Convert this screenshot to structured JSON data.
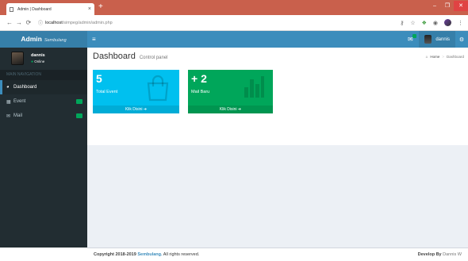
{
  "browser": {
    "tab_title": "Admin | Dashboard",
    "tab_close": "×",
    "new_tab": "+",
    "url_host": "localhost",
    "url_path": "/simpeg/admin/admin.php",
    "controls": {
      "minimize": "–",
      "maximize": "❐",
      "close": "✕"
    }
  },
  "header": {
    "logo_main": "Admin",
    "logo_sub": "Sembulang",
    "user_name": "dannis"
  },
  "sidebar": {
    "user_name": "dannis",
    "user_status": "Online",
    "section_header": "MAIN NAVIGATION",
    "items": [
      {
        "label": "Dashboard",
        "icon": "dashboard-icon",
        "active": true
      },
      {
        "label": "Event",
        "icon": "calendar-icon",
        "badge": ""
      },
      {
        "label": "Mail",
        "icon": "mail-icon",
        "badge": ""
      }
    ]
  },
  "page": {
    "title": "Dashboard",
    "subtitle": "Control panel",
    "breadcrumb": {
      "home": "Home",
      "current": "Dashboard"
    }
  },
  "boxes": [
    {
      "number": "5",
      "label": "Total Event",
      "footer": "Klik Disini",
      "color": "#00c0ef",
      "icon": "shopping-bag-icon"
    },
    {
      "number": "+ 2",
      "label": "Mail Baru",
      "footer": "Klik Disini",
      "color": "#00a65a",
      "icon": "bar-chart-icon"
    }
  ],
  "footer": {
    "copyright": "Copyright 2018-2019",
    "link": "Sembulang.",
    "rights": "All rights reserved.",
    "develop_label": "Develop By",
    "developer": "Dannis W"
  },
  "colors": {
    "brand": "#3c8dbc",
    "brand_dark": "#367fa9",
    "sidebar": "#222d32",
    "aqua": "#00c0ef",
    "green": "#00a65a",
    "browser_frame": "#c9604c"
  }
}
